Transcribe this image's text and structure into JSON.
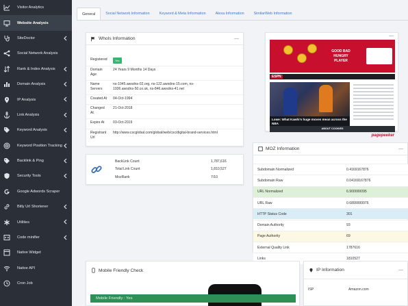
{
  "sidebar": {
    "items": [
      {
        "label": "Visitor Analytics",
        "icon": "chart-line-icon",
        "chevron": false,
        "active": false
      },
      {
        "label": "Website Analysis",
        "icon": "monitor-icon",
        "chevron": false,
        "active": true
      },
      {
        "label": "SiteDoctor",
        "icon": "stethoscope-icon",
        "chevron": true,
        "active": false
      },
      {
        "label": "Social Network Analysis",
        "icon": "share-icon",
        "chevron": false,
        "active": false
      },
      {
        "label": "Rank & Index Analysis",
        "icon": "sort-icon",
        "chevron": true,
        "active": false
      },
      {
        "label": "Domain Analysis",
        "icon": "bars-icon",
        "chevron": true,
        "active": false
      },
      {
        "label": "IP Analysis",
        "icon": "map-marker-icon",
        "chevron": true,
        "active": false
      },
      {
        "label": "Link Analysis",
        "icon": "anchor-icon",
        "chevron": true,
        "active": false
      },
      {
        "label": "Keyword Analysis",
        "icon": "tags-icon",
        "chevron": true,
        "active": false
      },
      {
        "label": "Keyword Position Tracking",
        "icon": "target-icon",
        "chevron": true,
        "active": false
      },
      {
        "label": "Backlink & Ping",
        "icon": "tag-icon",
        "chevron": true,
        "active": false
      },
      {
        "label": "Security Tools",
        "icon": "shield-icon",
        "chevron": true,
        "active": false
      },
      {
        "label": "Google Adwords Scraper",
        "icon": "google-icon",
        "chevron": false,
        "active": false
      },
      {
        "label": "Bitly Url Shortener",
        "icon": "link-icon",
        "chevron": true,
        "active": false
      },
      {
        "label": "Utilities",
        "icon": "asterisk-icon",
        "chevron": true,
        "active": false
      },
      {
        "label": "Code minifier",
        "icon": "code-icon",
        "chevron": true,
        "active": false
      },
      {
        "label": "Native Widget",
        "icon": "widget-icon",
        "chevron": false,
        "active": false
      },
      {
        "label": "Native API",
        "icon": "wifi-icon",
        "chevron": false,
        "active": false
      },
      {
        "label": "Cron Job",
        "icon": "clock-icon",
        "chevron": false,
        "active": false
      }
    ]
  },
  "tabs": [
    {
      "label": "General",
      "active": true
    },
    {
      "label": "Social Network Information",
      "active": false
    },
    {
      "label": "Keyword & Meta Information",
      "active": false
    },
    {
      "label": "Alexa Information",
      "active": false
    },
    {
      "label": "SimilarWeb Information",
      "active": false
    }
  ],
  "whois": {
    "title": "WhoIs Information",
    "rows": [
      {
        "label": "Registered",
        "value": "Yes",
        "badge": true
      },
      {
        "label": "Domain Age",
        "value": "24 Years 9 Months 14 Days"
      },
      {
        "label": "Name Servers",
        "value": "ns-1045.awsdns-02.org, ns-122.awsdns-15.com, ns-1936.awsdns-50.co.uk, ns-846.awsdns-41.net"
      },
      {
        "label": "Created At",
        "value": "04-Oct-1994"
      },
      {
        "label": "Changed At",
        "value": "21-Oct-2018"
      },
      {
        "label": "Expire At",
        "value": "03-Oct-2019"
      },
      {
        "label": "Registrant Url",
        "value": "http://www.cscglobal.com/global/web/csc/digital-brand-services.html"
      }
    ]
  },
  "backlink": {
    "rows": [
      {
        "label": "BackLink Count",
        "value": "1,787,616"
      },
      {
        "label": "Total Link Count",
        "value": "1,810,527"
      },
      {
        "label": "MozRank",
        "value": "7/10"
      }
    ]
  },
  "screenshot": {
    "logo": "ESPN",
    "ad_lines": [
      "GOOD BAD",
      "HUNGRY",
      "PLAYER"
    ],
    "caption": "Lowe: What Kawhi's huge moves mean across the NBA",
    "cookie_text": "ABOUT COOKIES",
    "brand": "pagepeeker"
  },
  "moz": {
    "title": "MOZ Information",
    "rows": [
      {
        "label": "Subdomain Normalized",
        "value": "0.4169167876",
        "color": "#ffffff"
      },
      {
        "label": "Subdomain Raw",
        "value": "0.04169167876",
        "color": "#ffffff"
      },
      {
        "label": "URL Normalized",
        "value": "6.900000095",
        "color": "#dff0d8"
      },
      {
        "label": "URL Raw",
        "value": "0.6899999976",
        "color": "#ffffff"
      },
      {
        "label": "HTTP Status Code",
        "value": "301",
        "color": "#d9edf7"
      },
      {
        "label": "Domain Authority",
        "value": "93",
        "color": "#ffffff"
      },
      {
        "label": "Page Authority",
        "value": "69",
        "color": "#fcf8e3"
      },
      {
        "label": "External Quality Link",
        "value": "1787616",
        "color": "#ffffff"
      },
      {
        "label": "Links",
        "value": "1810527",
        "color": "#ffffff"
      }
    ]
  },
  "mobile": {
    "title": "Mobile Friendly Check",
    "result_label": "Mobile Friendly : Yes"
  },
  "ip": {
    "title": "IP Information",
    "rows": [
      {
        "label": "ISP",
        "value": "Amazon.com"
      }
    ]
  },
  "colors": {
    "sidebar_bg": "#2b3038",
    "accent_link": "#3d78c8",
    "success": "#2e8f57",
    "espn_red": "#c8102e"
  }
}
